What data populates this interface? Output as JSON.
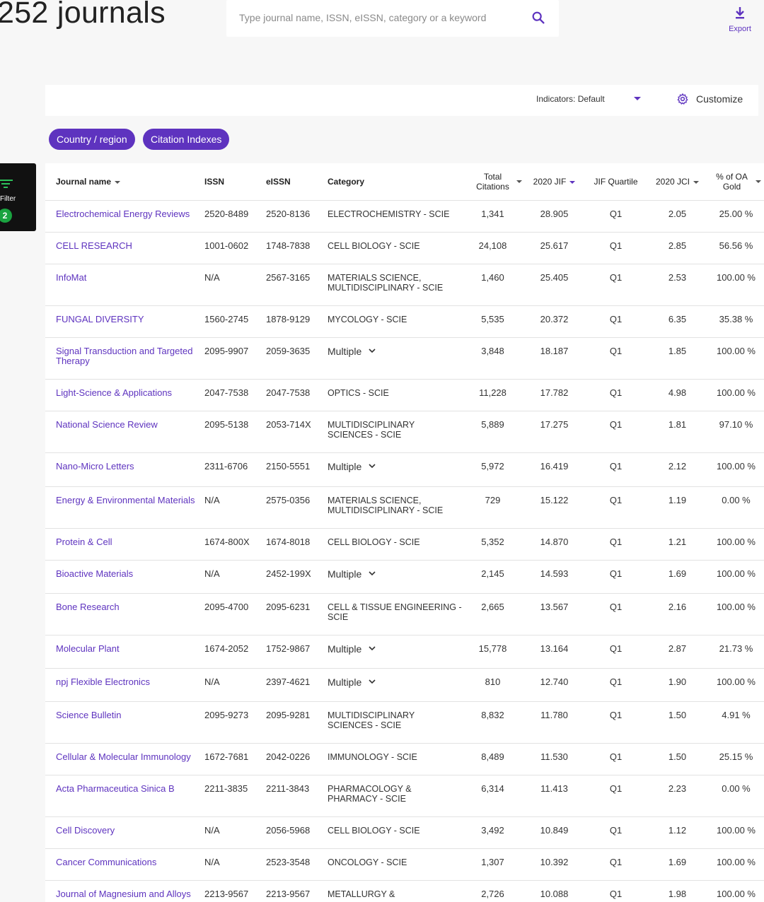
{
  "header": {
    "title": "252 journals",
    "search_placeholder": "Type journal name, ISSN, eISSN, category or a keyword",
    "search_icon": "search-icon",
    "export_label": "Export",
    "export_icon": "download-icon"
  },
  "indicators": {
    "label": "Indicators: Default",
    "customize_label": "Customize",
    "customize_icon": "gear-icon"
  },
  "chips": {
    "country": "Country / region",
    "citation": "Citation Indexes"
  },
  "filter": {
    "label": "Filter",
    "count": "2"
  },
  "colors": {
    "accent": "#5e33bf",
    "badge_green": "#1aa340"
  },
  "table": {
    "headers": {
      "name": "Journal name",
      "issn": "ISSN",
      "eissn": "eISSN",
      "category": "Category",
      "total_citations_1": "Total",
      "total_citations_2": "Citations",
      "jif": "2020 JIF",
      "quartile": "JIF Quartile",
      "jci": "2020 JCI",
      "oa_1": "% of OA",
      "oa_2": "Gold"
    },
    "rows": [
      {
        "name": "Electrochemical Energy Reviews",
        "issn": "2520-8489",
        "eissn": "2520-8136",
        "category": "ELECTROCHEMISTRY - SCIE",
        "multiple": false,
        "citations": "1,341",
        "jif": "28.905",
        "quartile": "Q1",
        "jci": "2.05",
        "oa": "25.00 %"
      },
      {
        "name": "CELL RESEARCH",
        "issn": "1001-0602",
        "eissn": "1748-7838",
        "category": "CELL BIOLOGY - SCIE",
        "multiple": false,
        "citations": "24,108",
        "jif": "25.617",
        "quartile": "Q1",
        "jci": "2.85",
        "oa": "56.56 %"
      },
      {
        "name": "InfoMat",
        "issn": "N/A",
        "eissn": "2567-3165",
        "category": "MATERIALS SCIENCE, MULTIDISCIPLINARY - SCIE",
        "multiple": false,
        "citations": "1,460",
        "jif": "25.405",
        "quartile": "Q1",
        "jci": "2.53",
        "oa": "100.00 %"
      },
      {
        "name": "FUNGAL DIVERSITY",
        "issn": "1560-2745",
        "eissn": "1878-9129",
        "category": "MYCOLOGY - SCIE",
        "multiple": false,
        "citations": "5,535",
        "jif": "20.372",
        "quartile": "Q1",
        "jci": "6.35",
        "oa": "35.38 %"
      },
      {
        "name": "Signal Transduction and Targeted Therapy",
        "issn": "2095-9907",
        "eissn": "2059-3635",
        "category": "Multiple",
        "multiple": true,
        "citations": "3,848",
        "jif": "18.187",
        "quartile": "Q1",
        "jci": "1.85",
        "oa": "100.00 %"
      },
      {
        "name": "Light-Science & Applications",
        "issn": "2047-7538",
        "eissn": "2047-7538",
        "category": "OPTICS - SCIE",
        "multiple": false,
        "citations": "11,228",
        "jif": "17.782",
        "quartile": "Q1",
        "jci": "4.98",
        "oa": "100.00 %"
      },
      {
        "name": "National Science Review",
        "issn": "2095-5138",
        "eissn": "2053-714X",
        "category": "MULTIDISCIPLINARY SCIENCES - SCIE",
        "multiple": false,
        "citations": "5,889",
        "jif": "17.275",
        "quartile": "Q1",
        "jci": "1.81",
        "oa": "97.10 %"
      },
      {
        "name": "Nano-Micro Letters",
        "issn": "2311-6706",
        "eissn": "2150-5551",
        "category": "Multiple",
        "multiple": true,
        "citations": "5,972",
        "jif": "16.419",
        "quartile": "Q1",
        "jci": "2.12",
        "oa": "100.00 %"
      },
      {
        "name": "Energy & Environmental Materials",
        "issn": "N/A",
        "eissn": "2575-0356",
        "category": "MATERIALS SCIENCE, MULTIDISCIPLINARY - SCIE",
        "multiple": false,
        "citations": "729",
        "jif": "15.122",
        "quartile": "Q1",
        "jci": "1.19",
        "oa": "0.00 %"
      },
      {
        "name": "Protein & Cell",
        "issn": "1674-800X",
        "eissn": "1674-8018",
        "category": "CELL BIOLOGY - SCIE",
        "multiple": false,
        "citations": "5,352",
        "jif": "14.870",
        "quartile": "Q1",
        "jci": "1.21",
        "oa": "100.00 %"
      },
      {
        "name": "Bioactive Materials",
        "issn": "N/A",
        "eissn": "2452-199X",
        "category": "Multiple",
        "multiple": true,
        "citations": "2,145",
        "jif": "14.593",
        "quartile": "Q1",
        "jci": "1.69",
        "oa": "100.00 %"
      },
      {
        "name": "Bone Research",
        "issn": "2095-4700",
        "eissn": "2095-6231",
        "category": "CELL & TISSUE ENGINEERING - SCIE",
        "multiple": false,
        "citations": "2,665",
        "jif": "13.567",
        "quartile": "Q1",
        "jci": "2.16",
        "oa": "100.00 %"
      },
      {
        "name": "Molecular Plant",
        "issn": "1674-2052",
        "eissn": "1752-9867",
        "category": "Multiple",
        "multiple": true,
        "citations": "15,778",
        "jif": "13.164",
        "quartile": "Q1",
        "jci": "2.87",
        "oa": "21.73 %"
      },
      {
        "name": "npj Flexible Electronics",
        "issn": "N/A",
        "eissn": "2397-4621",
        "category": "Multiple",
        "multiple": true,
        "citations": "810",
        "jif": "12.740",
        "quartile": "Q1",
        "jci": "1.90",
        "oa": "100.00 %"
      },
      {
        "name": "Science Bulletin",
        "issn": "2095-9273",
        "eissn": "2095-9281",
        "category": "MULTIDISCIPLINARY SCIENCES - SCIE",
        "multiple": false,
        "citations": "8,832",
        "jif": "11.780",
        "quartile": "Q1",
        "jci": "1.50",
        "oa": "4.91 %"
      },
      {
        "name": "Cellular & Molecular Immunology",
        "issn": "1672-7681",
        "eissn": "2042-0226",
        "category": "IMMUNOLOGY - SCIE",
        "multiple": false,
        "citations": "8,489",
        "jif": "11.530",
        "quartile": "Q1",
        "jci": "1.50",
        "oa": "25.15 %"
      },
      {
        "name": "Acta Pharmaceutica Sinica B",
        "issn": "2211-3835",
        "eissn": "2211-3843",
        "category": "PHARMACOLOGY & PHARMACY - SCIE",
        "multiple": false,
        "citations": "6,314",
        "jif": "11.413",
        "quartile": "Q1",
        "jci": "2.23",
        "oa": "0.00 %"
      },
      {
        "name": "Cell Discovery",
        "issn": "N/A",
        "eissn": "2056-5968",
        "category": "CELL BIOLOGY - SCIE",
        "multiple": false,
        "citations": "3,492",
        "jif": "10.849",
        "quartile": "Q1",
        "jci": "1.12",
        "oa": "100.00 %"
      },
      {
        "name": "Cancer Communications",
        "issn": "N/A",
        "eissn": "2523-3548",
        "category": "ONCOLOGY - SCIE",
        "multiple": false,
        "citations": "1,307",
        "jif": "10.392",
        "quartile": "Q1",
        "jci": "1.69",
        "oa": "100.00 %"
      },
      {
        "name": "Journal of Magnesium and Alloys",
        "issn": "2213-9567",
        "eissn": "2213-9567",
        "category": "METALLURGY &",
        "multiple": false,
        "citations": "2,726",
        "jif": "10.088",
        "quartile": "Q1",
        "jci": "1.98",
        "oa": "100.00 %"
      }
    ]
  }
}
